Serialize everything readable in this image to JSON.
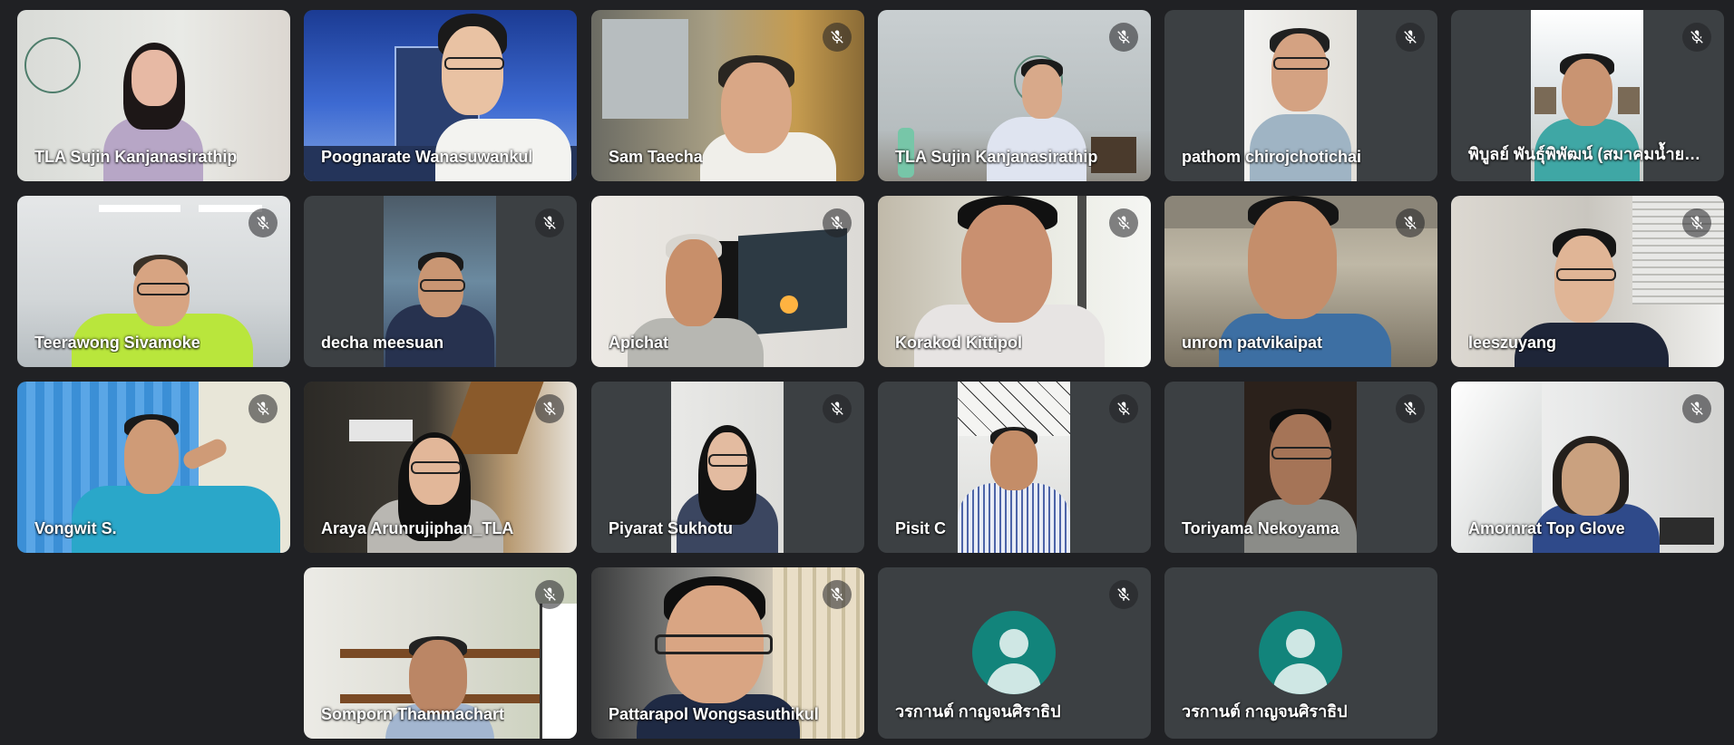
{
  "participants": [
    {
      "name": "TLA Sujin Kanjanasirathip",
      "muted": false
    },
    {
      "name": "Poognarate Wanasuwankul",
      "muted": false
    },
    {
      "name": "Sam Taecha",
      "muted": true
    },
    {
      "name": "TLA Sujin Kanjanasirathip",
      "muted": true
    },
    {
      "name": "pathom chirojchotichai",
      "muted": true
    },
    {
      "name": "พิบูลย์ พันธุ์พิพัฒน์ (สมาคมน้ำยาง...",
      "muted": true
    },
    {
      "name": "Teerawong Sivamoke",
      "muted": true
    },
    {
      "name": "decha meesuan",
      "muted": true
    },
    {
      "name": "Apichat",
      "muted": true
    },
    {
      "name": "Korakod Kittipol",
      "muted": true
    },
    {
      "name": "unrom patvikaipat",
      "muted": true
    },
    {
      "name": "leeszuyang",
      "muted": true
    },
    {
      "name": "Vongwit S.",
      "muted": true
    },
    {
      "name": "Araya Arunrujiphan_TLA",
      "muted": true
    },
    {
      "name": "Piyarat Sukhotu",
      "muted": true
    },
    {
      "name": "Pisit C",
      "muted": true
    },
    {
      "name": "Toriyama Nekoyama",
      "muted": true
    },
    {
      "name": "Amornrat Top Glove",
      "muted": true
    },
    {
      "name": "Somporn Thammachart",
      "muted": true
    },
    {
      "name": "Pattarapol Wongsasuthikul",
      "muted": true
    },
    {
      "name": "วรกานต์ กาญจนศิราธิป",
      "muted": true
    },
    {
      "name": "วรกานต์ กาญจนศิราธิป",
      "muted": false
    }
  ],
  "icons": {
    "muted": "mic-off-icon",
    "avatar": "avatar-placeholder"
  },
  "colors": {
    "background": "#202124",
    "tile": "#3c4043",
    "avatar": "#12847b"
  }
}
